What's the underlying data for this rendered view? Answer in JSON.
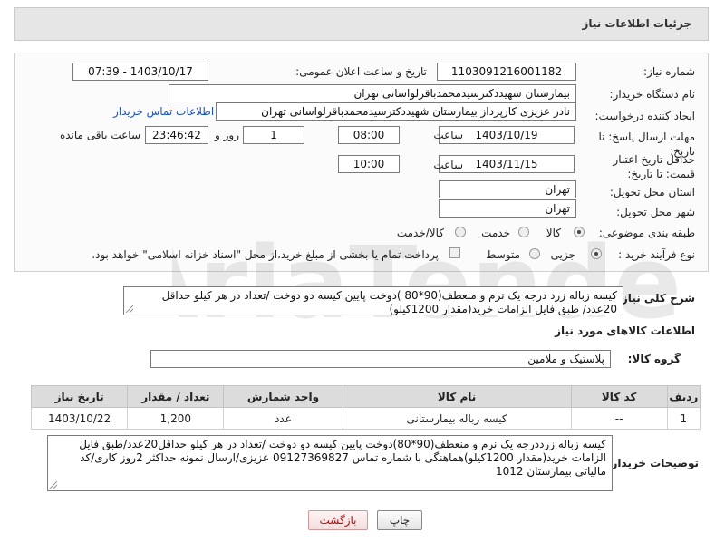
{
  "header": {
    "title": "جزئیات اطلاعات نیاز"
  },
  "form": {
    "need_number_label": "شماره نیاز:",
    "need_number": "1103091216001182",
    "announce_label": "تاریخ و ساعت اعلان عمومی:",
    "announce_value": "1403/10/17 - 07:39",
    "buyer_org_label": "نام دستگاه خریدار:",
    "buyer_org": "بیمارستان شهیددکترسیدمحمدباقرلواسانی تهران",
    "creator_label": "ایجاد کننده درخواست:",
    "creator": "نادر  عزیزی کارپرداز بیمارستان شهیددکترسیدمحمدباقرلواسانی تهران",
    "contact_link": "اطلاعات تماس خریدار",
    "deadline_label": "مهلت ارسال پاسخ: تا تاریخ:",
    "deadline_date": "1403/10/19",
    "time_label": "ساعت",
    "deadline_time": "08:00",
    "days_value": "1",
    "days_label": "روز و",
    "remaining_time": "23:46:42",
    "remaining_label": "ساعت باقی مانده",
    "validity_label": "حداقل تاریخ اعتبار قیمت: تا تاریخ:",
    "validity_date": "1403/11/15",
    "validity_time": "10:00",
    "province_label": "استان محل تحویل:",
    "province": "تهران",
    "city_label": "شهر محل تحویل:",
    "city": "تهران",
    "category_label": "طبقه بندی موضوعی:",
    "category_options": [
      "کالا",
      "خدمت",
      "کالا/خدمت"
    ],
    "purchase_type_label": "نوع فرآیند خرید :",
    "purchase_options": [
      "جزیی",
      "متوسط"
    ],
    "payment_note": "پرداخت تمام یا بخشی از مبلغ خرید،از محل \"اسناد خزانه اسلامی\" خواهد بود."
  },
  "description": {
    "label": "شرح کلی نیاز:",
    "text": "کیسه زباله زرد درجه یک نرم و منعطف(90*80 )دوخت پایین کیسه دو دوخت /تعداد در هر کیلو حداقل 20عدد/ طبق فایل الزامات خرید(مقدار 1200کیلو)"
  },
  "goods": {
    "section_title": "اطلاعات کالاهای مورد نیاز",
    "group_label": "گروه کالا:",
    "group_value": "پلاستیک و ملامین",
    "columns": [
      "ردیف",
      "کد کالا",
      "نام کالا",
      "واحد شمارش",
      "تعداد / مقدار",
      "تاریخ نیاز"
    ],
    "rows": [
      [
        "1",
        "--",
        "کیسه زباله بیمارستانی",
        "عدد",
        "1,200",
        "1403/10/22"
      ]
    ]
  },
  "buyer_notes": {
    "label": "توضیحات خریدار:",
    "text": "کیسه زباله زرددرجه یک نرم و منعطف(90*80)دوخت پایین کیسه دو دوخت /تعداد در هر کیلو حداقل20عدد/طبق فایل الزامات خرید(مقدار 1200کیلو)هماهنگی با شماره تماس 09127369827 عزیزی/ارسال نمونه حداکثر 2روز کاری/کد مالیاتی بیمارستان 1012"
  },
  "buttons": {
    "print": "چاپ",
    "back": "بازگشت"
  }
}
